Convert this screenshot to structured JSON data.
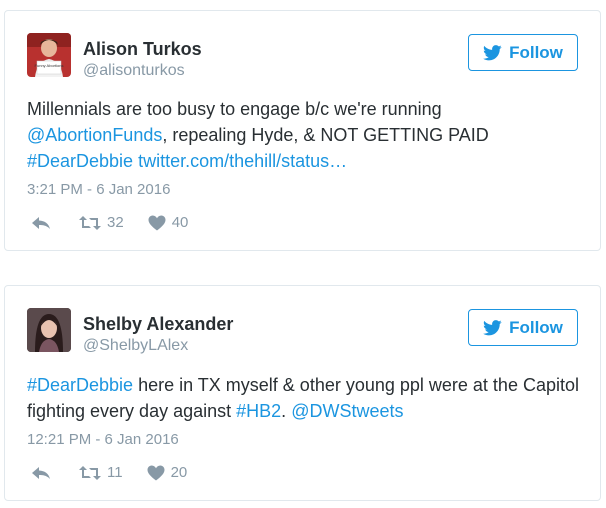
{
  "tweets": [
    {
      "name": "Alison Turkos",
      "handle": "@alisonturkos",
      "follow_label": "Follow",
      "text_plain_1": "Millennials are too busy to engage b/c we're running ",
      "mention_1": "@AbortionFunds",
      "text_plain_2": ", repealing Hyde, & NOT GETTING PAID ",
      "hashtag_1": "#DearDebbie",
      "text_plain_3": " ",
      "url": "twitter.com/thehill/status…",
      "timestamp": "3:21 PM - 6 Jan 2016",
      "retweets": "32",
      "likes": "40",
      "avatar_sign_text": "Funny Abortions"
    },
    {
      "name": "Shelby Alexander",
      "handle": "@ShelbyLAlex",
      "follow_label": "Follow",
      "hashtag_1": "#DearDebbie",
      "text_plain_1": " here in TX myself & other young ppl were at the Capitol fighting every day against ",
      "hashtag_2": "#HB2",
      "text_plain_2": ". ",
      "mention_1": "@DWStweets",
      "timestamp": "12:21 PM - 6 Jan 2016",
      "retweets": "11",
      "likes": "20"
    }
  ],
  "colors": {
    "link": "#1b95e0",
    "muted": "#8899a6",
    "text": "#292f33",
    "border": "#e1e8ed"
  },
  "icons": [
    "bird-icon",
    "reply-icon",
    "retweet-icon",
    "heart-icon"
  ]
}
